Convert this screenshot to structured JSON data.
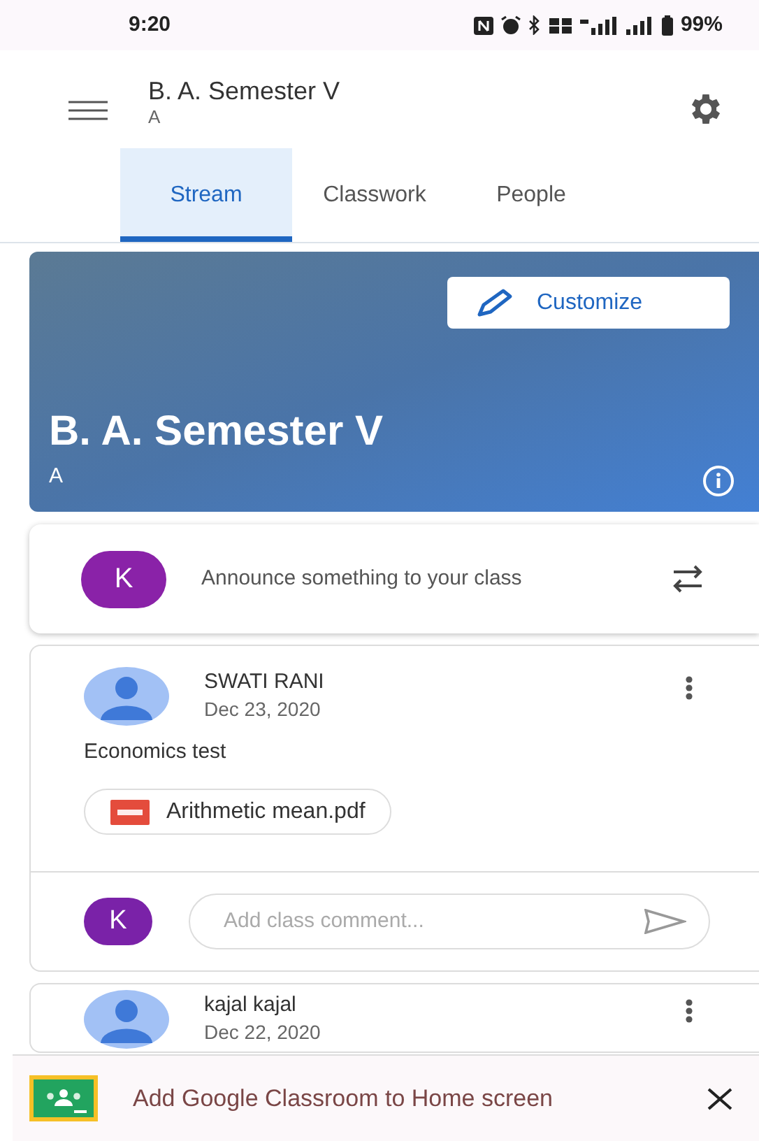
{
  "status_bar": {
    "time": "9:20",
    "battery": "99%"
  },
  "header": {
    "title": "B. A. Semester V",
    "subtitle": "A"
  },
  "tabs": [
    {
      "label": "Stream",
      "selected": true
    },
    {
      "label": "Classwork",
      "selected": false
    },
    {
      "label": "People",
      "selected": false
    }
  ],
  "class_banner": {
    "title": "B. A. Semester V",
    "section": "A",
    "customize_button": "Customize"
  },
  "announce": {
    "avatar": "K",
    "placeholder": "Announce something to your class"
  },
  "posts": [
    {
      "author": "SWATI RANI",
      "date": "Dec 23, 2020",
      "text": "Economics test",
      "attachment": "Arithmetic mean.pdf",
      "comment_avatar": "K",
      "comment_placeholder": "Add class comment..."
    },
    {
      "author": "kajal kajal",
      "date": "Dec 22, 2020"
    }
  ],
  "install_banner": {
    "text": "Add Google Classroom to Home screen"
  }
}
